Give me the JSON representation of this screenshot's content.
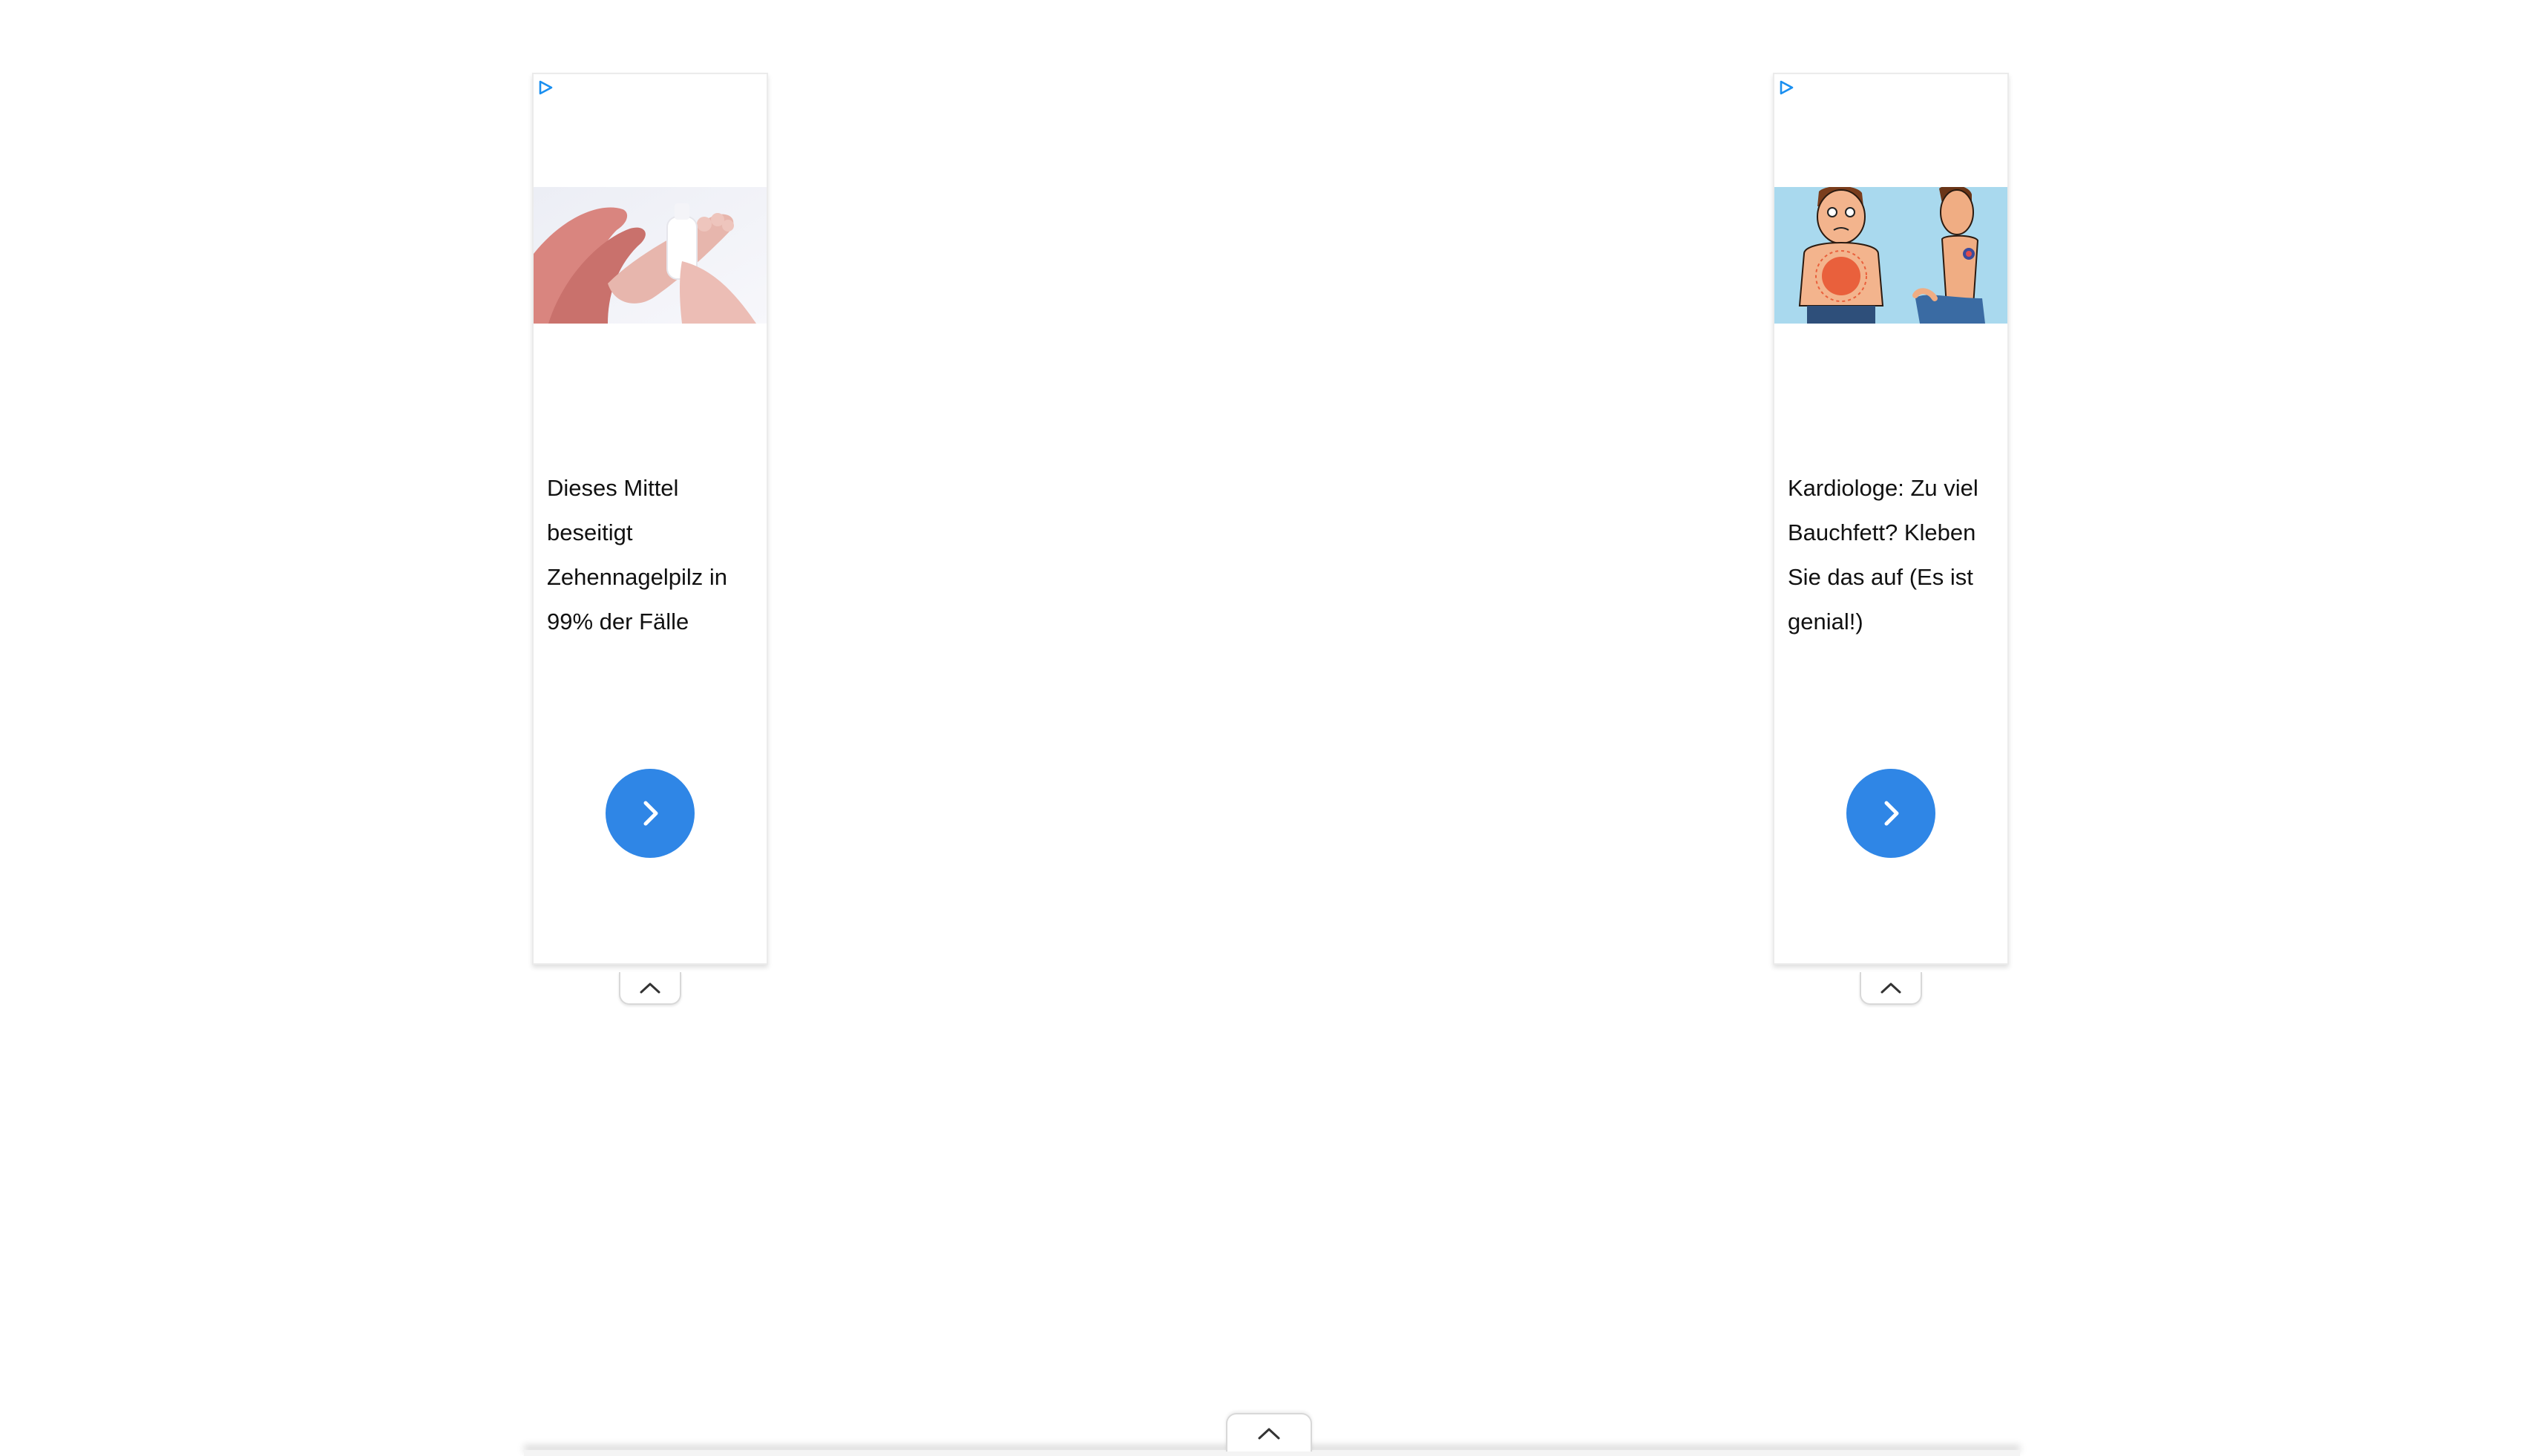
{
  "colors": {
    "accent": "#2f86e6",
    "adchoices": "#1a8ff0",
    "border": "#ebebeb",
    "text": "#111111"
  },
  "ads": [
    {
      "image_icon": "foot-spray-photo",
      "text": "Dieses Mittel beseitigt Zehennagelpilz in 99% der Fälle",
      "button_icon": "chevron-right-icon"
    },
    {
      "image_icon": "belly-fat-cartoon",
      "text": "Kardiologe: Zu viel Bauchfett? Kleben Sie das auf (Es ist genial!)",
      "button_icon": "chevron-right-icon"
    }
  ],
  "controls": {
    "collapse_icon": "chevron-up-icon",
    "bottom_expand_icon": "chevron-up-icon"
  }
}
